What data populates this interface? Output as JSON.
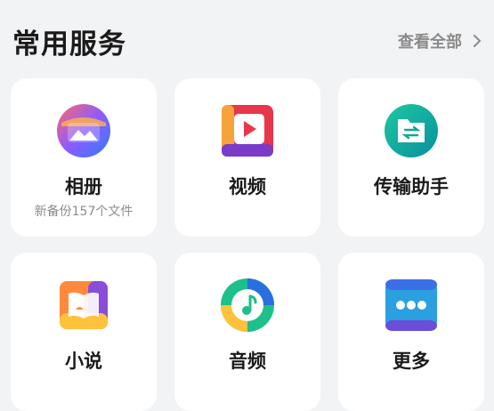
{
  "section": {
    "title": "常用服务",
    "view_all_label": "查看全部"
  },
  "services": [
    {
      "label": "相册",
      "subtitle": "新备份157个文件",
      "icon": "photo-album-icon"
    },
    {
      "label": "视频",
      "icon": "video-play-icon"
    },
    {
      "label": "传输助手",
      "icon": "transfer-folder-icon"
    },
    {
      "label": "小说",
      "icon": "open-book-icon"
    },
    {
      "label": "音频",
      "icon": "music-note-icon"
    },
    {
      "label": "更多",
      "icon": "more-dots-icon"
    }
  ],
  "colors": {
    "background": "#f2f3f5",
    "card": "#ffffff",
    "title_text": "#1a1a1a",
    "secondary_text": "#8a8a8a"
  }
}
